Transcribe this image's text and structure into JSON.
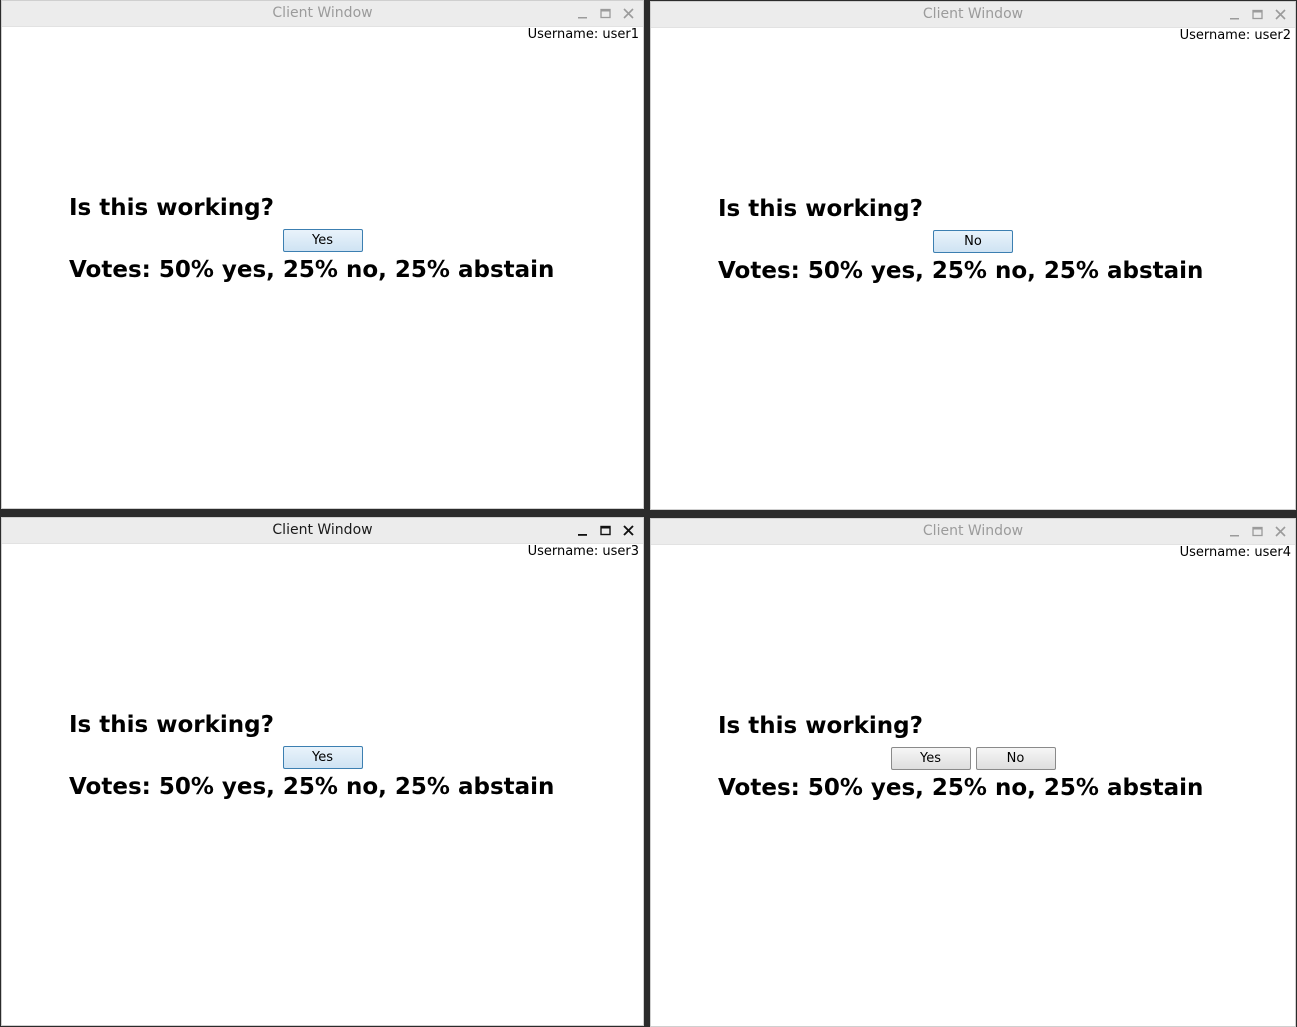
{
  "windows": [
    {
      "title": "Client Window",
      "username": "Username: user1",
      "question": "Is this working?",
      "buttons": [
        "Yes"
      ],
      "votes": "Votes: 50% yes, 25% no, 25% abstain",
      "active": false
    },
    {
      "title": "Client Window",
      "username": "Username: user2",
      "question": "Is this working?",
      "buttons": [
        "No"
      ],
      "votes": "Votes: 50% yes, 25% no, 25% abstain",
      "active": false
    },
    {
      "title": "Client Window",
      "username": "Username: user3",
      "question": "Is this working?",
      "buttons": [
        "Yes"
      ],
      "votes": "Votes: 50% yes, 25% no, 25% abstain",
      "active": true
    },
    {
      "title": "Client Window",
      "username": "Username: user4",
      "question": "Is this working?",
      "buttons": [
        "Yes",
        "No"
      ],
      "votes": "Votes: 50% yes, 25% no, 25% abstain",
      "active": false
    }
  ],
  "icons": {
    "minimize": "minimize-icon",
    "maximize": "maximize-icon",
    "close": "close-icon"
  },
  "colors": {
    "titlebar": "#ececec",
    "title_inactive": "#9b9b9b",
    "title_active": "#1a1a1a",
    "window_bg": "#ffffff",
    "desktop_bg": "#2b2b2b"
  }
}
